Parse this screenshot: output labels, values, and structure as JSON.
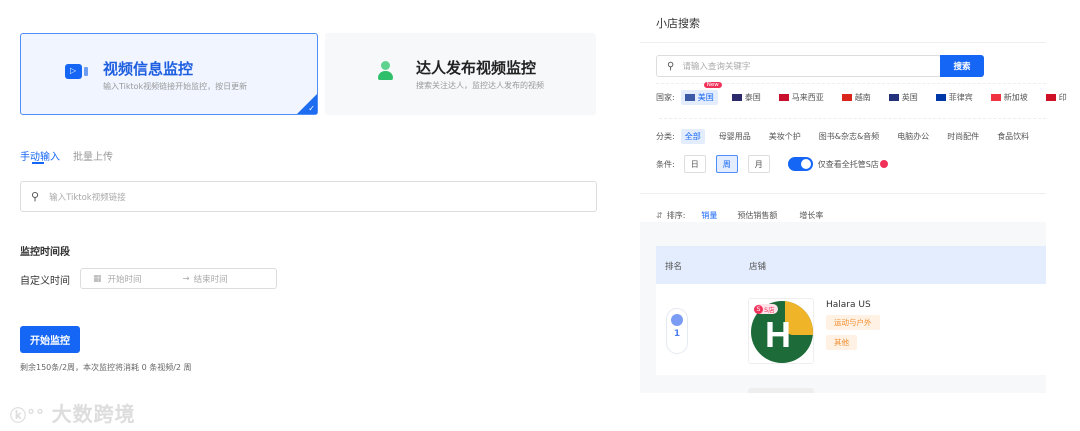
{
  "left": {
    "cards": [
      {
        "title": "视频信息监控",
        "desc": "输入Tiktok视频链接开始监控，按日更新",
        "selected": true
      },
      {
        "title": "达人发布视频监控",
        "desc": "搜索关注达人，监控达人发布的视频",
        "selected": false
      }
    ],
    "tabs": [
      "手动输入",
      "批量上传"
    ],
    "link_placeholder": "输入Tiktok视频链接",
    "period_label": "监控时间段",
    "custom_time_label": "自定义时间",
    "start_placeholder": "开始时间",
    "arrow": "→",
    "end_placeholder": "结束时间",
    "start_button": "开始监控",
    "quota_text": "剩余150条/2周，本次监控将消耗 0 条视频/2 周",
    "watermark": "大数跨境"
  },
  "right": {
    "title": "小店搜索",
    "search_placeholder": "请输入查询关键字",
    "search_button": "搜索",
    "country_label": "国家:",
    "new_badge": "New",
    "countries": [
      {
        "name": "美国",
        "color": "#3c5aa6"
      },
      {
        "name": "泰国",
        "color": "#2d2a6b"
      },
      {
        "name": "马来西亚",
        "color": "#c8102e"
      },
      {
        "name": "越南",
        "color": "#da251d"
      },
      {
        "name": "英国",
        "color": "#23327a"
      },
      {
        "name": "菲律宾",
        "color": "#0038a8"
      },
      {
        "name": "新加坡",
        "color": "#ef3340"
      },
      {
        "name": "印",
        "color": "#ce1126"
      }
    ],
    "category_label": "分类:",
    "categories": [
      "全部",
      "母婴用品",
      "美妆个护",
      "图书&杂志&音频",
      "电脑办公",
      "时尚配件",
      "食品饮料"
    ],
    "condition_label": "条件:",
    "conditions": [
      "日",
      "周",
      "月"
    ],
    "toggle_label": "仅查看全托管S店",
    "toggle_on": true,
    "sort_label": "排序:",
    "sort_tabs": [
      "销量",
      "预估销售额",
      "增长率"
    ],
    "table_headers": [
      "排名",
      "店铺"
    ],
    "rows": [
      {
        "rank": "1",
        "badge": "S店",
        "shop": "Halara US",
        "tags": [
          "运动与户外",
          "其他"
        ]
      }
    ]
  }
}
